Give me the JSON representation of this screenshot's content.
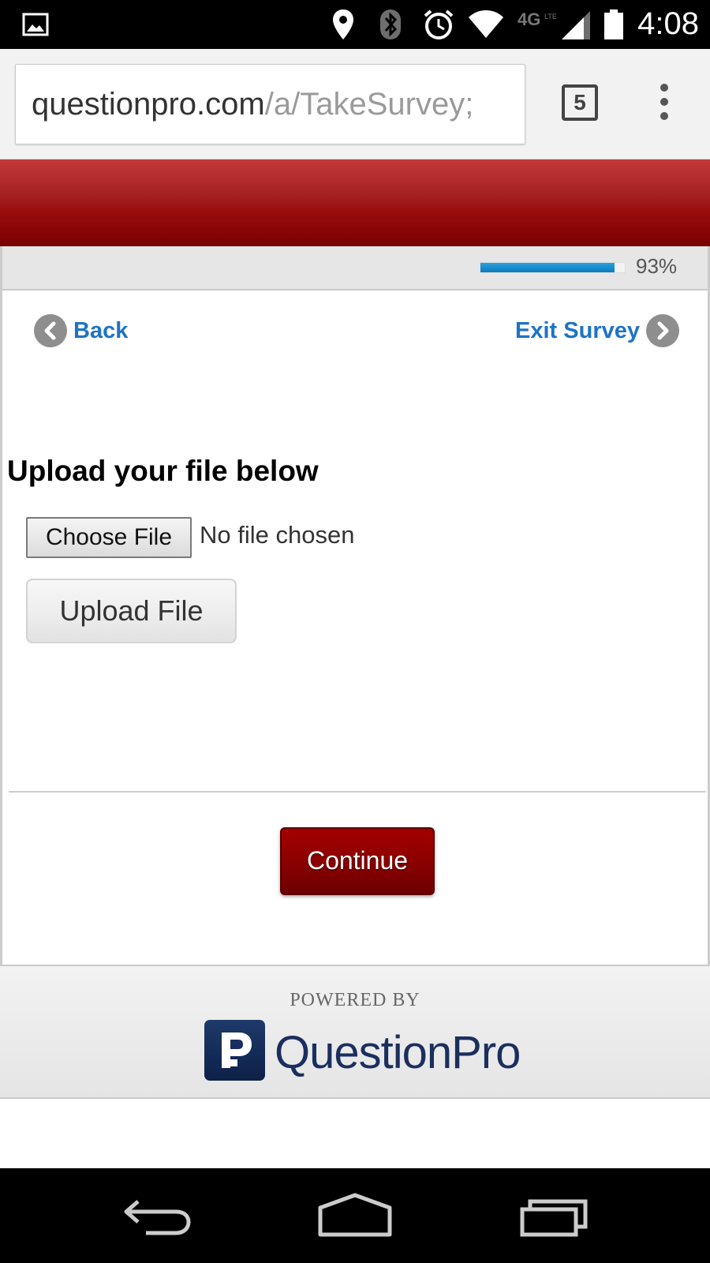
{
  "status_bar": {
    "time": "4:08",
    "icons": [
      "image-icon",
      "location-icon",
      "bluetooth-icon",
      "alarm-icon",
      "wifi-icon",
      "4g-lte-icon",
      "signal-icon",
      "battery-icon"
    ]
  },
  "browser": {
    "url_domain": "questionpro.com",
    "url_path": "/a/TakeSurvey;",
    "tab_count": "5",
    "menu_icon": "overflow-menu-icon"
  },
  "progress": {
    "percent_label": "93%",
    "fraction": 0.93,
    "fill_color": "#168dd0"
  },
  "survey_nav": {
    "back_label": "Back",
    "exit_label": "Exit Survey",
    "link_color": "#1d73c7"
  },
  "question": {
    "title": "Upload your file below",
    "choose_file_label": "Choose File",
    "file_status": "No file chosen",
    "upload_button_label": "Upload File"
  },
  "actions": {
    "continue_label": "Continue",
    "continue_color": "#8c0000"
  },
  "footer": {
    "powered_by": "POWERED BY",
    "brand_name": "QuestionPro",
    "brand_color": "#1b2f5e"
  },
  "system_nav": {
    "icons": [
      "back-nav-icon",
      "home-nav-icon",
      "recents-nav-icon"
    ]
  }
}
